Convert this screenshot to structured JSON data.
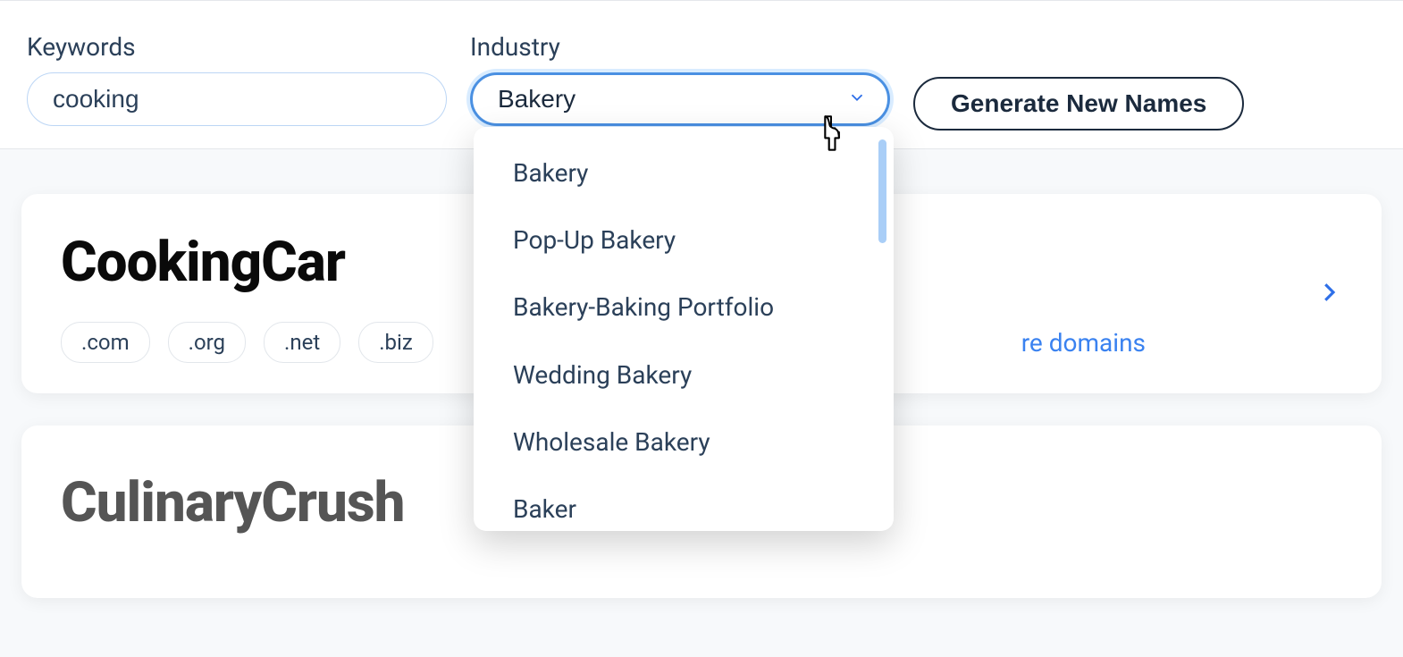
{
  "form": {
    "keywords_label": "Keywords",
    "keywords_value": "cooking",
    "industry_label": "Industry",
    "industry_value": "Bakery",
    "generate_button": "Generate New Names"
  },
  "dropdown": {
    "options": [
      "Bakery",
      "Pop-Up Bakery",
      "Bakery-Baking Portfolio",
      "Wedding Bakery",
      "Wholesale Bakery",
      "Baker"
    ]
  },
  "results": [
    {
      "name": "CookingCar",
      "domains": [
        ".com",
        ".org",
        ".net",
        ".biz"
      ],
      "more_label": "re domains"
    },
    {
      "name": "CulinaryCrush"
    }
  ]
}
